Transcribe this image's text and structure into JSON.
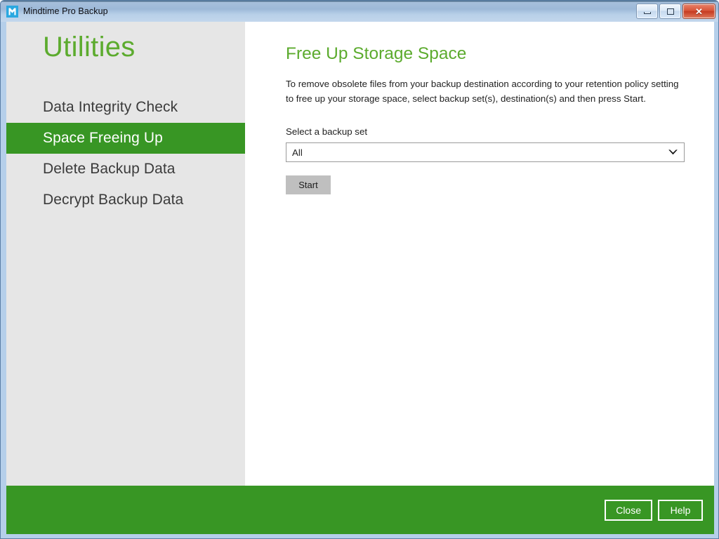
{
  "window": {
    "title": "Mindtime Pro Backup",
    "icon": "app-logo-icon",
    "controls": {
      "minimize_label": "Minimize",
      "maximize_label": "Maximize",
      "close_label": "✕"
    },
    "accent_green": "#389624",
    "heading_green": "#5cab2e",
    "sidebar_bg": "#e6e6e6"
  },
  "sidebar": {
    "title": "Utilities",
    "items": [
      {
        "label": "Data Integrity Check",
        "active": false
      },
      {
        "label": "Space Freeing Up",
        "active": true
      },
      {
        "label": "Delete Backup Data",
        "active": false
      },
      {
        "label": "Decrypt Backup Data",
        "active": false
      }
    ]
  },
  "main": {
    "heading": "Free Up Storage Space",
    "description": "To remove obsolete files from your backup destination according to your retention policy setting to free up your storage space, select backup set(s), destination(s) and then press Start.",
    "field_label": "Select a backup set",
    "backup_set_select": {
      "value": "All",
      "options": [
        "All"
      ],
      "arrow_icon": "chevron-down-icon"
    },
    "start_label": "Start"
  },
  "footer": {
    "close_label": "Close",
    "help_label": "Help"
  }
}
